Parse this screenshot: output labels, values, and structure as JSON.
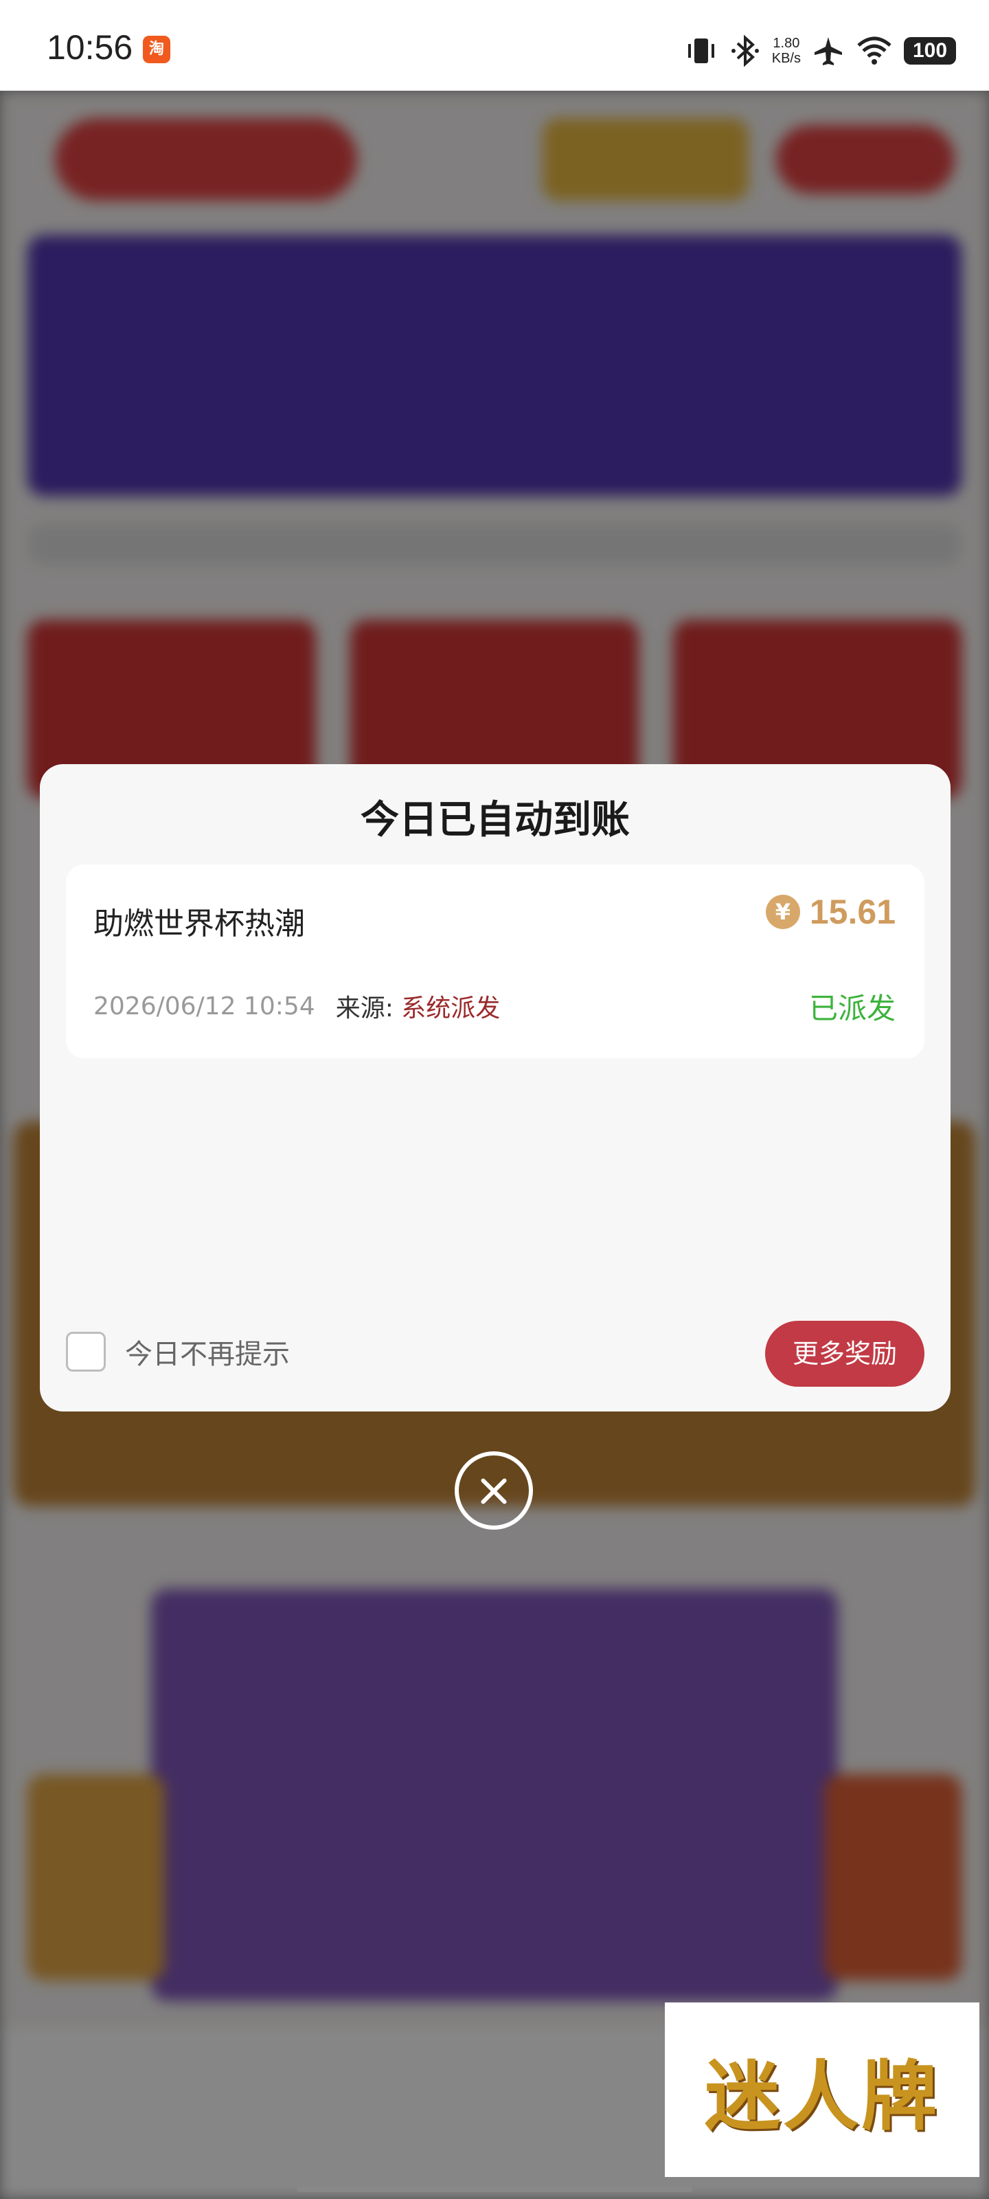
{
  "status_bar": {
    "time": "10:56",
    "app_badge": "淘",
    "net_speed_value": "1.80",
    "net_speed_unit": "KB/s",
    "battery": "100"
  },
  "modal": {
    "title": "今日已自动到账",
    "reward": {
      "name": "助燃世界杯热潮",
      "currency_symbol": "¥",
      "amount": "15.61",
      "datetime": "2026/06/12 10:54",
      "source_label": "来源:",
      "source_value": "系统派发",
      "status": "已派发"
    },
    "dont_show_label": "今日不再提示",
    "more_button_label": "更多奖励"
  },
  "watermark": {
    "text": "迷人牌"
  },
  "colors": {
    "accent_red": "#c13a45",
    "amount_gold": "#cf9b5e",
    "status_green": "#3cb33c",
    "source_red": "#9b2a2a"
  },
  "icons": [
    "vibrate-icon",
    "bluetooth-icon",
    "airplane-icon",
    "wifi-icon",
    "coin-icon",
    "close-icon"
  ]
}
